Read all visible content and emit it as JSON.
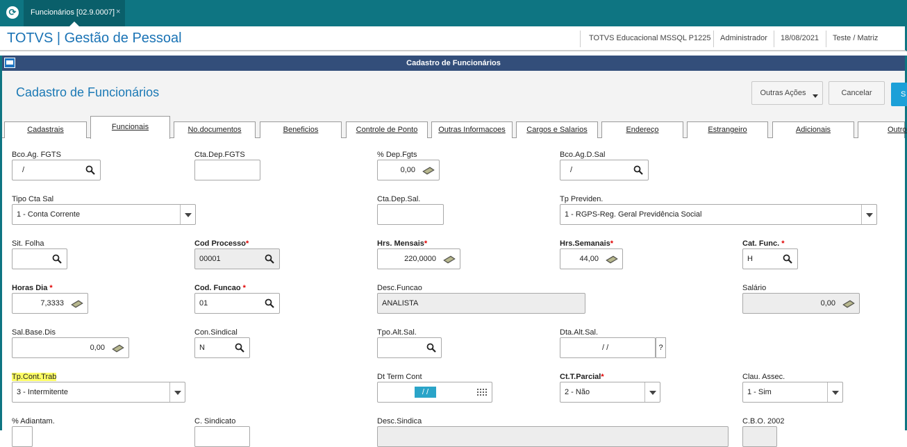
{
  "app_tab": {
    "label": "Funcionários [02.9.0007]",
    "close": "×"
  },
  "header": {
    "brand": "TOTVS | Gestão de Pessoal",
    "environment": "TOTVS Educacional MSSQL P1225",
    "user": "Administrador",
    "date": "18/08/2021",
    "company": "Teste / Matriz"
  },
  "window": {
    "title": "Cadastro de Funcionários"
  },
  "form": {
    "title": "Cadastro de Funcionários",
    "other_actions": "Outras Ações",
    "cancel": "Cancelar",
    "save": "S"
  },
  "tabs": [
    {
      "label": "Cadastrais"
    },
    {
      "label": "Funcionais"
    },
    {
      "label": "No.documentos"
    },
    {
      "label": "Beneficios"
    },
    {
      "label": "Controle de Ponto"
    },
    {
      "label": "Outras Informacoes"
    },
    {
      "label": "Cargos e Salarios"
    },
    {
      "label": "Endereço"
    },
    {
      "label": "Estrangeiro"
    },
    {
      "label": "Adicionais"
    },
    {
      "label": "Outros"
    }
  ],
  "active_tab": "Funcionais",
  "colors": {
    "accent": "#0e7582",
    "brand_blue": "#1a73b5",
    "title_bar": "#334e7a",
    "required": "#e00000",
    "highlight": "#ffff66"
  },
  "fields": {
    "bco_ag_fgts": {
      "label": "Bco.Ag. FGTS",
      "value": "/"
    },
    "cta_dep_fgts": {
      "label": "Cta.Dep.FGTS",
      "value": ""
    },
    "pct_dep_fgts": {
      "label": "% Dep.Fgts",
      "value": "0,00"
    },
    "bco_ag_d_sal": {
      "label": "Bco.Ag.D.Sal",
      "value": "/"
    },
    "tipo_cta_sal": {
      "label": "Tipo Cta Sal",
      "value": "1 - Conta Corrente"
    },
    "cta_dep_sal": {
      "label": "Cta.Dep.Sal.",
      "value": ""
    },
    "tp_previden": {
      "label": "Tp Previden.",
      "value": "1 - RGPS-Reg. Geral Previdência Social"
    },
    "sit_folha": {
      "label": "Sit. Folha",
      "value": ""
    },
    "cod_processo": {
      "label": "Cod Processo",
      "value": "00001"
    },
    "hrs_mensais": {
      "label": "Hrs. Mensais",
      "value": "220,0000"
    },
    "hrs_semanais": {
      "label": "Hrs.Semanais",
      "value": "44,00"
    },
    "cat_func": {
      "label": "Cat. Func. ",
      "value": "H"
    },
    "horas_dia": {
      "label": "Horas Dia ",
      "value": "7,3333"
    },
    "cod_funcao": {
      "label": "Cod. Funcao ",
      "value": "01"
    },
    "desc_funcao": {
      "label": "Desc.Funcao",
      "value": "ANALISTA"
    },
    "salario": {
      "label": "Salário",
      "value": "0,00"
    },
    "sal_base_dis": {
      "label": "Sal.Base.Dis",
      "value": "0,00"
    },
    "con_sindical": {
      "label": "Con.Sindical",
      "value": "N"
    },
    "tpo_alt_sal": {
      "label": "Tpo.Alt.Sal.",
      "value": ""
    },
    "dta_alt_sal": {
      "label": "Dta.Alt.Sal.",
      "value": "/ /",
      "help": "?"
    },
    "tp_cont_trab": {
      "label": "Tp.Cont.Trab",
      "value": "3 - Intermitente"
    },
    "dt_term_cont": {
      "label": "Dt Term Cont",
      "value": "/ /"
    },
    "ct_t_parcial": {
      "label": "Ct.T.Parcial",
      "value": "2 - Não"
    },
    "clau_assec": {
      "label": "Clau. Assec.",
      "value": "1 - Sim"
    },
    "pct_adiantam": {
      "label": "% Adiantam."
    },
    "c_sindicato": {
      "label": "C. Sindicato"
    },
    "desc_sindica": {
      "label": "Desc.Sindica"
    },
    "cbo_2002": {
      "label": "C.B.O. 2002"
    }
  },
  "required_mark": "*"
}
